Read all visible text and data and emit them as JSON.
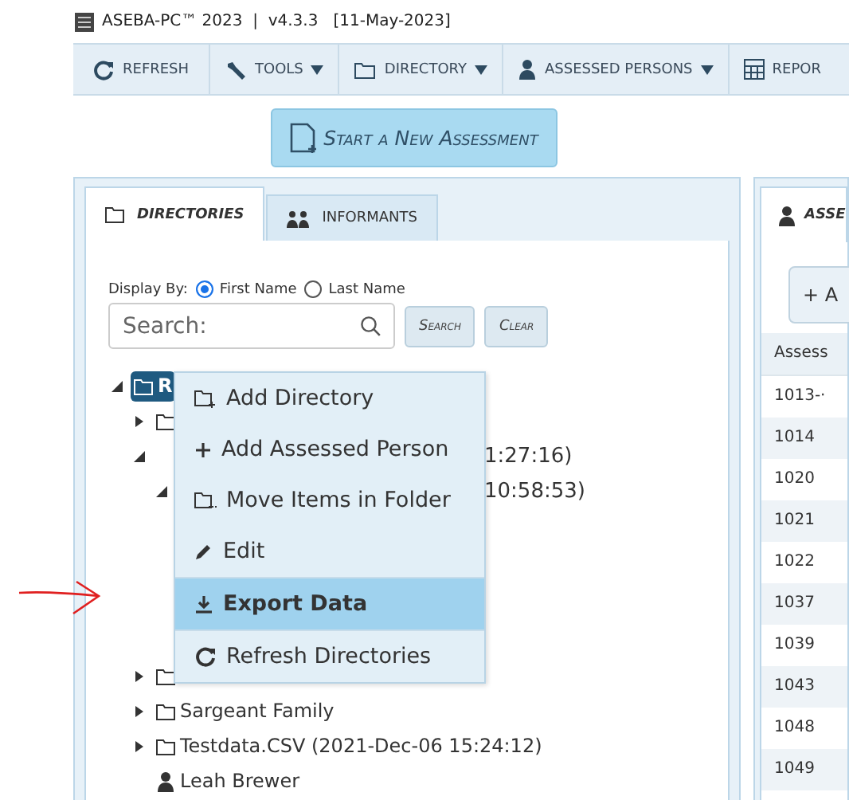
{
  "window": {
    "title": "ASEBA-PC™ 2023  |  v4.3.3   [11-May-2023]"
  },
  "toolbar": [
    {
      "kind": "refresh",
      "label": "REFRESH",
      "dropdown": false
    },
    {
      "kind": "tools",
      "label": "TOOLS",
      "dropdown": true
    },
    {
      "kind": "directory",
      "label": "DIRECTORY",
      "dropdown": true
    },
    {
      "kind": "person",
      "label": "ASSESSED PERSONS",
      "dropdown": true
    },
    {
      "kind": "report",
      "label": "REPOR",
      "dropdown": false
    }
  ],
  "start_button": {
    "label": "Start a New Assessment"
  },
  "left_panel": {
    "tabs": [
      {
        "kind": "folder",
        "label": "DIRECTORIES",
        "selected": true
      },
      {
        "kind": "people",
        "label": "INFORMANTS",
        "selected": false
      }
    ],
    "display_by": {
      "label": "Display By:",
      "options": [
        {
          "label": "First Name",
          "selected": true
        },
        {
          "label": "Last Name",
          "selected": false
        }
      ]
    },
    "search": {
      "placeholder": "Search:"
    },
    "buttons": [
      "Search",
      "Clear"
    ],
    "tree": [
      {
        "kind": "folder",
        "label": "R",
        "selected": true,
        "expanded": true,
        "children": [
          {
            "kind": "folder",
            "expanded": false,
            "selected": false
          },
          {
            "label": "1:27:16)",
            "covered": true,
            "expanded": true,
            "selected": false,
            "children": [
              {
                "label": "10:58:53)",
                "covered": true,
                "expanded": true,
                "selected": false
              }
            ]
          },
          {
            "kind": "folder",
            "expanded": false,
            "selected": false
          },
          {
            "kind": "folder",
            "label": "Sargeant Family",
            "expanded": false,
            "selected": false
          },
          {
            "kind": "folder",
            "label": "Testdata.CSV (2021-Dec-06 15:24:12)",
            "expanded": false,
            "selected": false
          },
          {
            "kind": "person",
            "label": "Leah Brewer",
            "selected": false
          }
        ]
      }
    ]
  },
  "context_menu": [
    {
      "kind": "add-folder",
      "label": "Add Directory",
      "selected": false
    },
    {
      "kind": "plus",
      "label": "Add Assessed Person",
      "selected": false
    },
    {
      "kind": "move",
      "label": "Move Items in Folder",
      "selected": false
    },
    {
      "kind": "edit",
      "label": "Edit",
      "selected": false
    },
    {
      "kind": "export",
      "label": "Export Data",
      "selected": true
    },
    {
      "kind": "refresh",
      "label": "Refresh Directories",
      "selected": false
    }
  ],
  "right_panel": {
    "tab": "ASSE",
    "add_button": "+ A",
    "table": {
      "columns": [
        "Assess"
      ],
      "rows": [
        "1013-·",
        "1014",
        "1020",
        "1021",
        "1022",
        "1037",
        "1039",
        "1043",
        "1048",
        "1049"
      ]
    }
  }
}
